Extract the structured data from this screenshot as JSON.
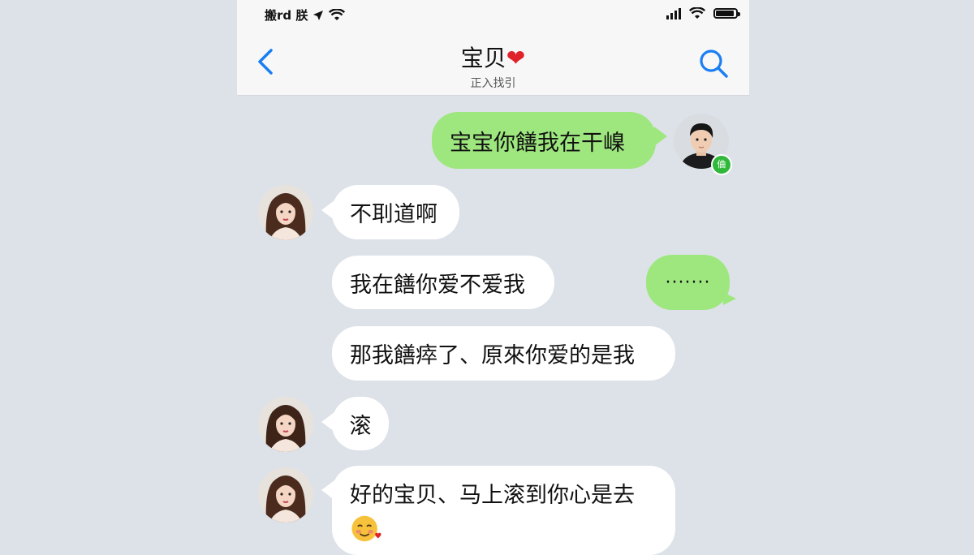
{
  "status_bar": {
    "left_text": "搬rd 朕",
    "battery_level": 1.0
  },
  "header": {
    "back_label": "<",
    "title": "宝贝",
    "title_emoji": "❤",
    "subtitle": "正入找引"
  },
  "messages": [
    {
      "sender": "me",
      "text": "宝宝你饍我在干嵲"
    },
    {
      "sender": "her",
      "text": "不刵道啊"
    },
    {
      "sender": "her",
      "text": "我在饍你爱不爱我"
    },
    {
      "sender": "me",
      "text": "·······"
    },
    {
      "sender": "her",
      "text": "那我饍瘁了、原來你爱的是我"
    },
    {
      "sender": "her",
      "text": "滚"
    },
    {
      "sender": "her",
      "text": "好的宝贝、马上滚到你心是去"
    }
  ],
  "emoji_icon": "smiling-face-with-hearts-icon",
  "online_badge": "㑋",
  "colors": {
    "green_bubble": "#9ee77f",
    "white_bubble": "#ffffff",
    "background": "#dde2e8",
    "accent_blue": "#1a7ef2",
    "heart": "#e0222a"
  }
}
